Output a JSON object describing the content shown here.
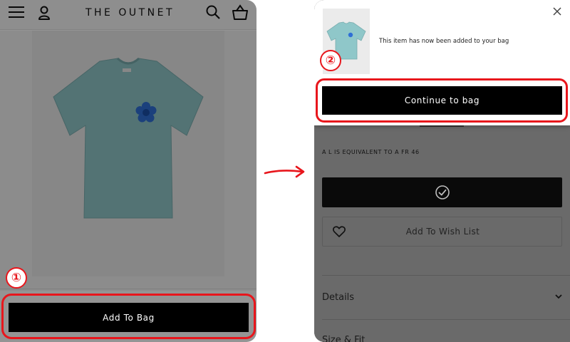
{
  "left_screen": {
    "brand": "THE OUTNET",
    "icons": {
      "menu": "hamburger-menu-icon",
      "account": "account-icon",
      "search": "search-icon",
      "bag": "shopping-bag-icon"
    },
    "add_to_bag_label": "Add To Bag",
    "step_marker": "①",
    "shirt_color": "#8fc7c9",
    "patch_color": "#2f6fd6"
  },
  "right_screen": {
    "added_message": "This item has now been added to your bag",
    "continue_label": "Continue to bag",
    "step_marker": "②",
    "size_note": "A L IS EQUIVALENT TO A FR 46",
    "wish_list_label": "Add To Wish List",
    "details_label": "Details",
    "size_fit_label": "Size & Fit"
  },
  "colors": {
    "highlight": "#e8161c",
    "button": "#000000"
  }
}
